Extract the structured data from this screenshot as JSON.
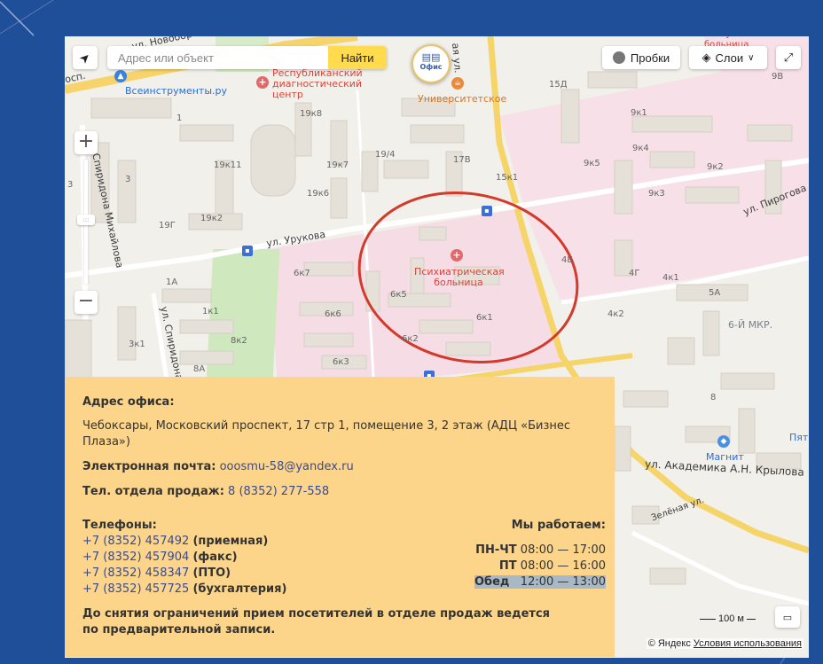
{
  "map": {
    "search_placeholder": "Адрес или объект",
    "search_button": "Найти",
    "traffic_button": "Пробки",
    "layers_button": "Слои",
    "office_marker_label": "Офис",
    "scale_label": "100 м",
    "copyright": "© Яндекс",
    "terms_link": "Условия использования",
    "highlight_color": "#d33a2c",
    "streets": [
      "ул. Урукова",
      "ул. Пирогова",
      "ул. Академика А.Н. Крылова",
      "Зелёная ул.",
      "ул. Спиридона Михайлова",
      "ул. Спиридона",
      "ая ул.",
      "ул. Новобор",
      "осп."
    ],
    "pois": {
      "hospital": "Психиатрическая больница",
      "diag_center": "Республиканский диагностический центр",
      "university": "Университетское",
      "instruments": "Всеинструменты.ру",
      "magnit": "Магнит",
      "district": "6-Й МКР.",
      "rep_hospital": "Республиканская больница",
      "pyat": "Пятё"
    },
    "buildings": [
      "19к8",
      "19к7",
      "19к6",
      "19к11",
      "19к2",
      "19/4",
      "19Г",
      "1",
      "3",
      "1А",
      "1к1",
      "3к1",
      "8к2",
      "8А",
      "6к7",
      "6к6",
      "6к3",
      "6к5",
      "6к2",
      "6к1",
      "17В",
      "15к1",
      "15Д",
      "9к1",
      "9к4",
      "9к5",
      "9к3",
      "9к2",
      "9В",
      "4Б",
      "4Г",
      "4к1",
      "4к2",
      "5А",
      "3",
      "8"
    ]
  },
  "info": {
    "address_title": "Адрес офиса:",
    "address": "Чебоксары, Московский проспект, 17 стр 1, помещение 3, 2 этаж (АДЦ «Бизнес Плаза»)",
    "email_label": "Электронная почта:",
    "email": "ooosmu-58@yandex.ru",
    "sales_label": "Тел. отдела продаж:",
    "sales_phone": "8 (8352) 277-558",
    "phones_title": "Телефоны:",
    "phones": [
      {
        "number": "+7 (8352) 457492",
        "note": "(приемная)"
      },
      {
        "number": "+7 (8352) 457904",
        "note": "(факс)"
      },
      {
        "number": "+7 (8352) 458347",
        "note": "(ПТО)"
      },
      {
        "number": "+7 (8352) 457725",
        "note": "(бухгалтерия)"
      }
    ],
    "hours_title": "Мы работаем:",
    "hours": [
      {
        "days": "ПН-ЧТ",
        "time": "08:00 — 17:00"
      },
      {
        "days": "ПТ",
        "time": "08:00 — 16:00"
      },
      {
        "days": "Обед",
        "time": "12:00 — 13:00"
      }
    ],
    "notice": "До снятия ограничений прием посетителей в отделе продаж ведется по предварительной записи."
  }
}
